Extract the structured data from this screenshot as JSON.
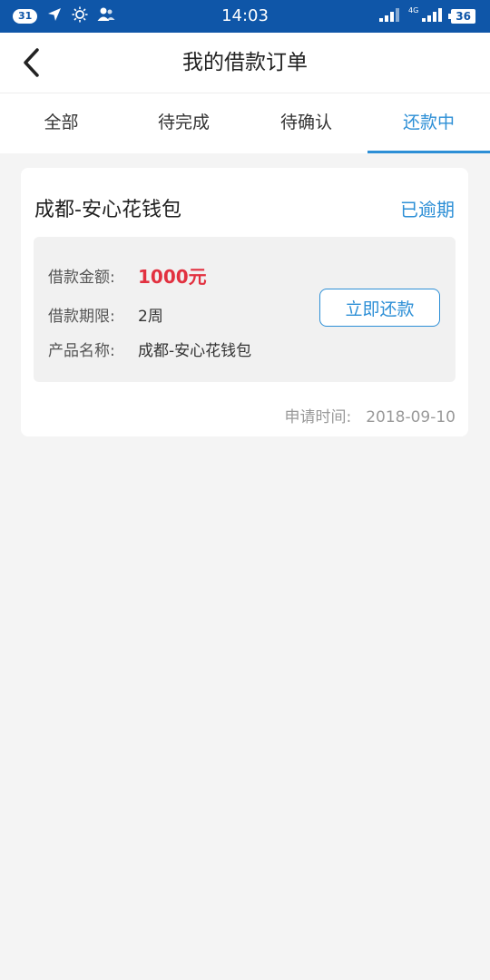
{
  "statusbar": {
    "badge": "31",
    "time": "14:03",
    "network": "4G",
    "battery": "36"
  },
  "header": {
    "title": "我的借款订单"
  },
  "tabs": [
    {
      "label": "全部",
      "active": false
    },
    {
      "label": "待完成",
      "active": false
    },
    {
      "label": "待确认",
      "active": false
    },
    {
      "label": "还款中",
      "active": true
    }
  ],
  "order": {
    "product_title": "成都-安心花钱包",
    "status": "已逾期",
    "amount_label": "借款金额:",
    "amount_value": "1000元",
    "term_label": "借款期限:",
    "term_value": "2周",
    "product_label": "产品名称:",
    "product_value": "成都-安心花钱包",
    "repay_button": "立即还款",
    "apply_time_label": "申请时间:",
    "apply_time_value": "2018-09-10"
  },
  "colors": {
    "statusbar": "#0f56a8",
    "accent": "#2d8fd6",
    "amount": "#e23140"
  }
}
